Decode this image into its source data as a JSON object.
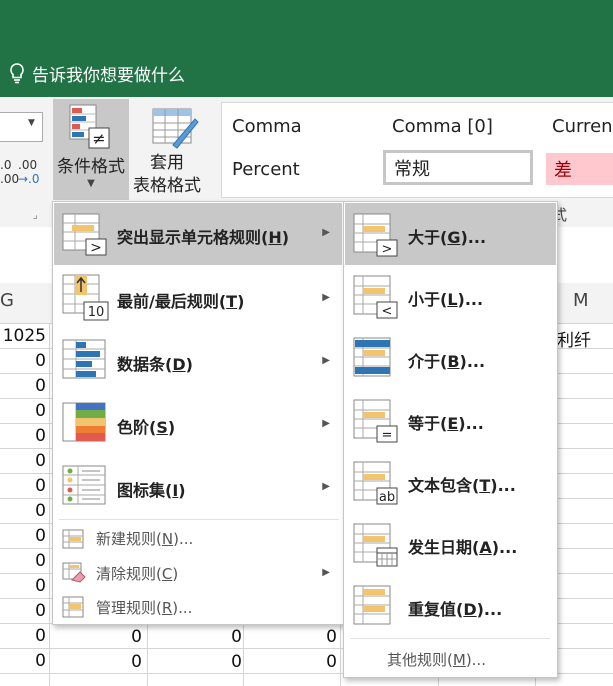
{
  "title_bar": {
    "tell_me": "告诉我你想要做什么"
  },
  "ribbon": {
    "number_format": {
      "inc_decimal_line1": ".0",
      "inc_decimal_line2": ".00",
      "dec_decimal_line1": ".00",
      "dec_decimal_line2": "→.0"
    },
    "conditional_formatting": {
      "label": "条件格式"
    },
    "format_as_table": {
      "line1": "套用",
      "line2": "表格格式"
    },
    "styles": {
      "comma": "Comma",
      "comma0": "Comma [0]",
      "currency": "Currenc",
      "percent": "Percent",
      "normal": "常规",
      "bad": "差",
      "group_label": "式"
    }
  },
  "columns": {
    "g": "G",
    "m": "M"
  },
  "grid": {
    "row0_g": "1025",
    "row0_m": "利纤",
    "zeros": [
      "0",
      "0",
      "0",
      "0",
      "0",
      "0",
      "0",
      "0",
      "0",
      "0",
      "0",
      "0",
      "0"
    ]
  },
  "menu_main": {
    "items": [
      {
        "label": "突出显示单元格规则(",
        "key": "H",
        "tail": ")",
        "icon": "highlight-cells-icon"
      },
      {
        "label": "最前/最后规则(",
        "key": "T",
        "tail": ")",
        "icon": "top-bottom-icon"
      },
      {
        "label": "数据条(",
        "key": "D",
        "tail": ")",
        "icon": "data-bars-icon"
      },
      {
        "label": "色阶(",
        "key": "S",
        "tail": ")",
        "icon": "color-scales-icon"
      },
      {
        "label": "图标集(",
        "key": "I",
        "tail": ")",
        "icon": "icon-sets-icon"
      }
    ],
    "new_rule": {
      "label": "新建规则(",
      "key": "N",
      "tail": ")..."
    },
    "clear_rules": {
      "label": "清除规则(",
      "key": "C",
      "tail": ")"
    },
    "manage_rules": {
      "label": "管理规则(",
      "key": "R",
      "tail": ")..."
    },
    "top_bottom_icon_number": "10",
    "icon_symbols": {
      "greater_than": ">",
      "not_equal": "≠"
    }
  },
  "menu_sub": {
    "items": [
      {
        "label": "大于(",
        "key": "G",
        "tail": ")...",
        "icon": "greater-than-icon",
        "sym": ">"
      },
      {
        "label": "小于(",
        "key": "L",
        "tail": ")...",
        "icon": "less-than-icon",
        "sym": "<"
      },
      {
        "label": "介于(",
        "key": "B",
        "tail": ")...",
        "icon": "between-icon",
        "sym": ""
      },
      {
        "label": "等于(",
        "key": "E",
        "tail": ")...",
        "icon": "equal-to-icon",
        "sym": "="
      },
      {
        "label": "文本包含(",
        "key": "T",
        "tail": ")...",
        "icon": "text-contains-icon",
        "sym": "ab"
      },
      {
        "label": "发生日期(",
        "key": "A",
        "tail": ")...",
        "icon": "date-occurring-icon",
        "sym": ""
      },
      {
        "label": "重复值(",
        "key": "D",
        "tail": ")...",
        "icon": "duplicate-values-icon",
        "sym": ""
      }
    ],
    "more_rules": {
      "label": "其他规则(",
      "key": "M",
      "tail": ")..."
    }
  },
  "colors": {
    "excel_green": "#217346",
    "highlight": "#c8c8c8",
    "bad_fill": "#ffc7ce",
    "bad_text": "#9c0006",
    "rule_yellow": "#f2c46d",
    "rule_blue": "#2e75b6"
  }
}
